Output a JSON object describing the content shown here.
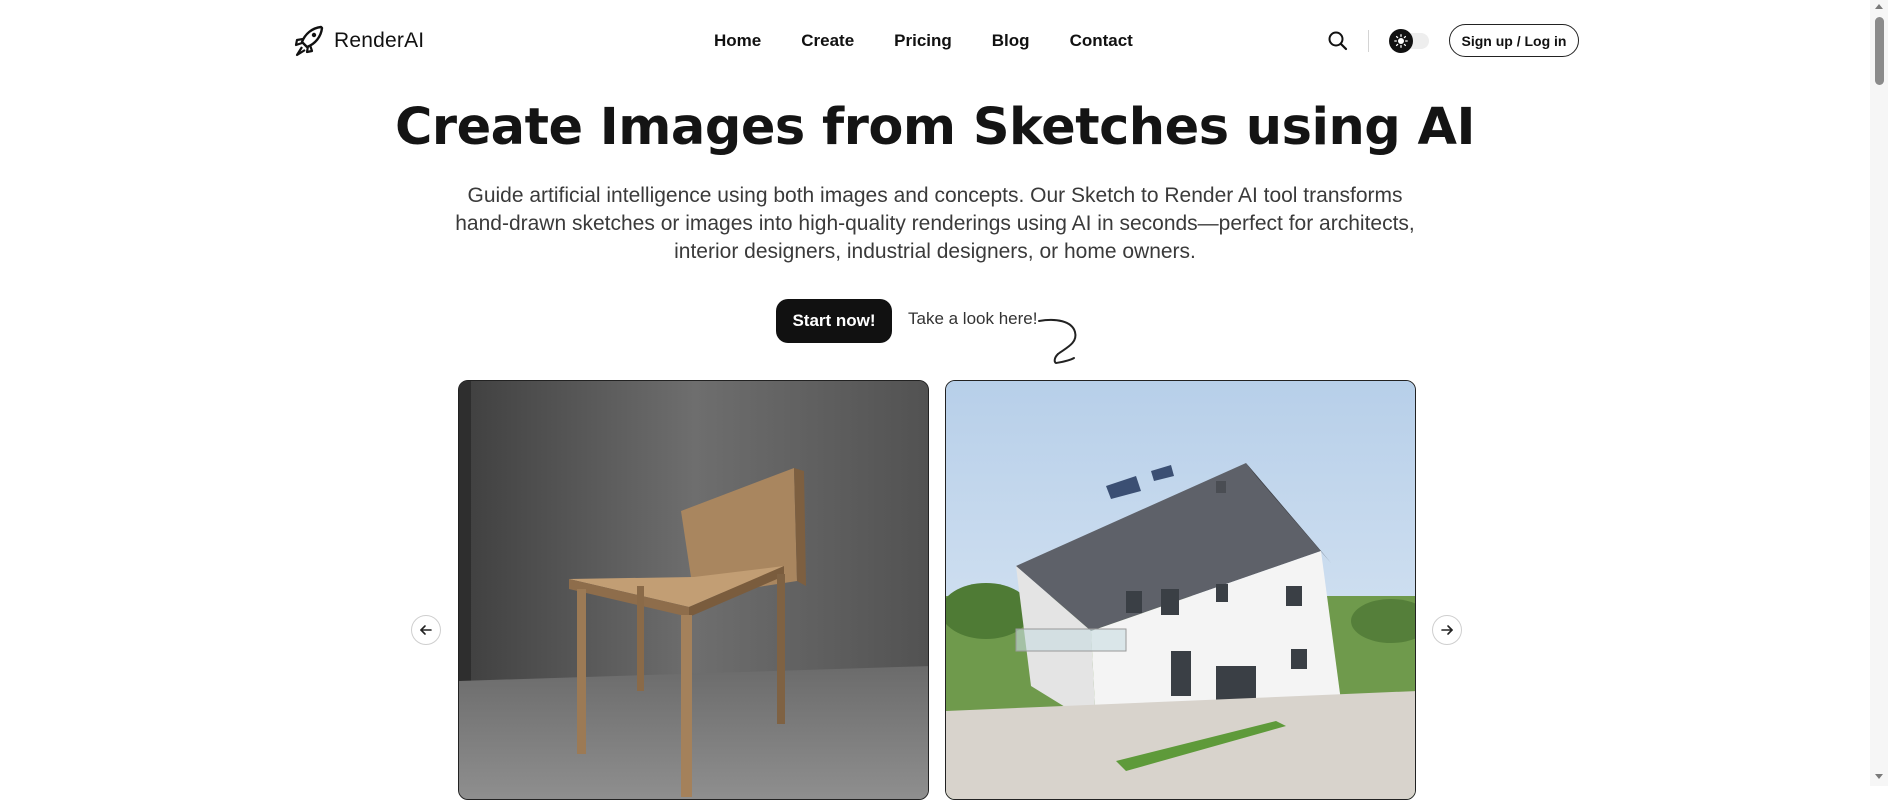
{
  "header": {
    "brand": "RenderAI",
    "logo_icon": "rocket-icon",
    "nav": [
      "Home",
      "Create",
      "Pricing",
      "Blog",
      "Contact"
    ],
    "search_icon": "search-icon",
    "theme_toggle_icon": "sun-icon",
    "auth_label": "Sign up / Log in"
  },
  "hero": {
    "title": "Create Images from Sketches using AI",
    "subtitle": "Guide artificial intelligence using both images and concepts. Our Sketch to Render AI tool transforms hand-drawn sketches or images into high-quality renderings using AI in seconds—perfect for architects, interior designers, industrial designers, or home owners.",
    "cta_label": "Start now!",
    "hint_label": "Take a look here!"
  },
  "carousel": {
    "prev_icon": "arrow-left-icon",
    "next_icon": "arrow-right-icon",
    "slides": [
      "wooden-chair-render",
      "white-house-render"
    ]
  },
  "colors": {
    "primary": "#111111",
    "background": "#ffffff",
    "text_muted": "#3a3a3a"
  }
}
